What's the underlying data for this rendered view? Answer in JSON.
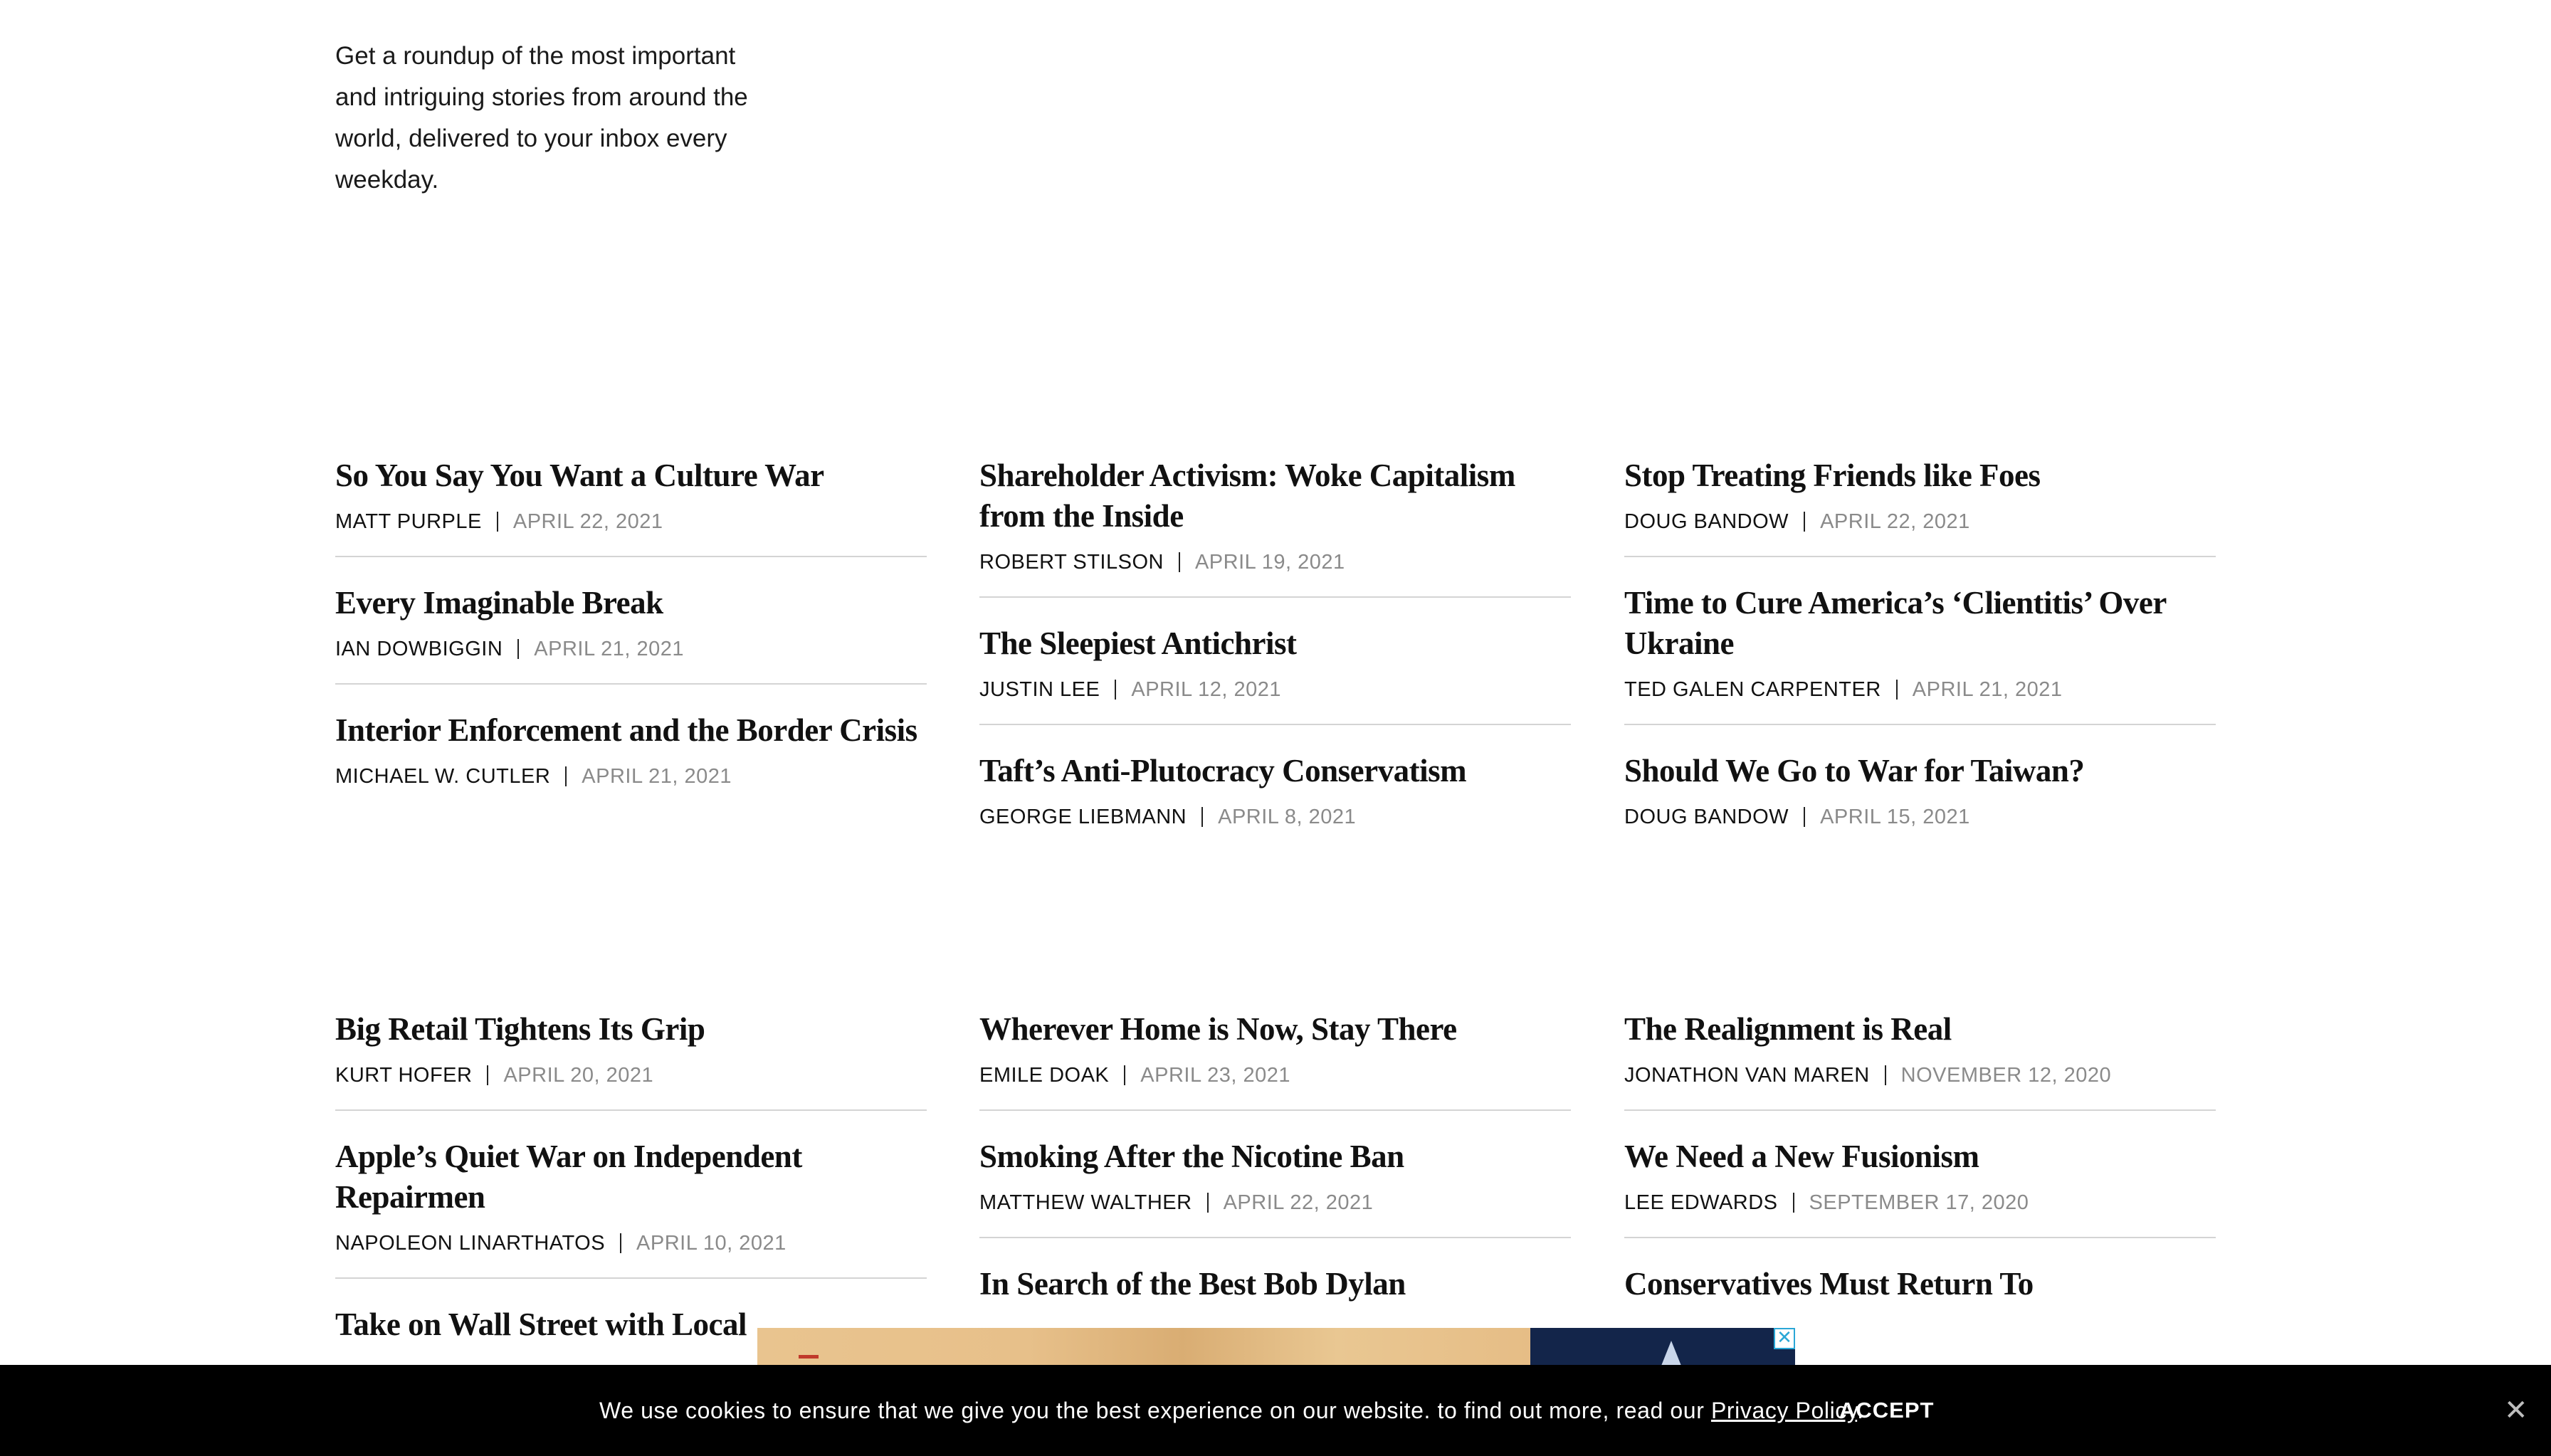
{
  "newsletter": {
    "description": "Get a roundup of the most important and intriguing stories from around the world, delivered to your inbox every weekday."
  },
  "sections": [
    {
      "columns": [
        {
          "articles": [
            {
              "title": "So You Say You Want a Culture War",
              "author": "MATT PURPLE",
              "date": "APRIL 22, 2021"
            },
            {
              "title": "Every Imaginable Break",
              "author": "IAN DOWBIGGIN",
              "date": "APRIL 21, 2021"
            },
            {
              "title": "Interior Enforcement and the Border Crisis",
              "author": "MICHAEL W. CUTLER",
              "date": "APRIL 21, 2021"
            }
          ]
        },
        {
          "articles": [
            {
              "title": "Shareholder Activism: Woke Capitalism from the Inside",
              "author": "ROBERT STILSON",
              "date": "APRIL 19, 2021"
            },
            {
              "title": "The Sleepiest Antichrist",
              "author": "JUSTIN LEE",
              "date": "APRIL 12, 2021"
            },
            {
              "title": "Taft’s Anti-Plutocracy Conservatism",
              "author": "GEORGE LIEBMANN",
              "date": "APRIL 8, 2021"
            }
          ]
        },
        {
          "articles": [
            {
              "title": "Stop Treating Friends like Foes",
              "author": "DOUG BANDOW",
              "date": "APRIL 22, 2021"
            },
            {
              "title": "Time to Cure America’s ‘Clientitis’ Over Ukraine",
              "author": "TED GALEN CARPENTER",
              "date": "APRIL 21, 2021"
            },
            {
              "title": "Should We Go to War for Taiwan?",
              "author": "DOUG BANDOW",
              "date": "APRIL 15, 2021"
            }
          ]
        }
      ]
    },
    {
      "columns": [
        {
          "articles": [
            {
              "title": "Big Retail Tightens Its Grip",
              "author": "KURT HOFER",
              "date": "APRIL 20, 2021"
            },
            {
              "title": "Apple’s Quiet War on Independent Repairmen",
              "author": "NAPOLEON LINARTHATOS",
              "date": "APRIL 10, 2021"
            },
            {
              "title": "Take on Wall Street with Local",
              "author": "",
              "date": ""
            }
          ]
        },
        {
          "articles": [
            {
              "title": "Wherever Home is Now, Stay There",
              "author": "EMILE DOAK",
              "date": "APRIL 23, 2021"
            },
            {
              "title": "Smoking After the Nicotine Ban",
              "author": "MATTHEW WALTHER",
              "date": "APRIL 22, 2021"
            },
            {
              "title": "In Search of the Best Bob Dylan",
              "author": "",
              "date": ""
            }
          ]
        },
        {
          "articles": [
            {
              "title": "The Realignment is Real",
              "author": "JONATHON VAN MAREN",
              "date": "NOVEMBER 12, 2020"
            },
            {
              "title": "We Need a New Fusionism",
              "author": "LEE EDWARDS",
              "date": "SEPTEMBER 17, 2020"
            },
            {
              "title": "Conservatives Must Return To",
              "author": "",
              "date": ""
            }
          ]
        }
      ]
    }
  ],
  "ad": {
    "close_label": "✕"
  },
  "cookie_banner": {
    "message": "We use cookies to ensure that we give you the best experience on our website. to find out more, read our ",
    "link_text": "Privacy Policy",
    "suffix": ".",
    "accept_label": "ACCEPT",
    "close_label": "✕"
  }
}
